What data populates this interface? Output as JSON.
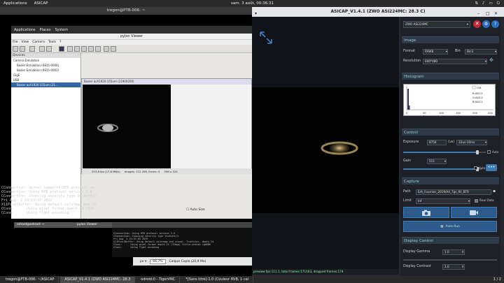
{
  "topbar": {
    "applications": "Applications",
    "app_name": "ASICAP",
    "datetime": "sam. 3 août, 00:36:31",
    "sys_icons": [
      "network-icon",
      "volume-icon",
      "battery-icon",
      "power-icon"
    ]
  },
  "vnc": {
    "title": "tregon@PTB-006: ~",
    "menu": [
      "Applications",
      "Places",
      "System"
    ],
    "pylon_title": "pylon Viewer",
    "pylon_menu": [
      "File",
      "View",
      "Camera",
      "Tools",
      "?"
    ],
    "devices_header": "Devices",
    "devices": [
      "Camera Emulation",
      "Basler Emulation (0815-0000)",
      "Basler Emulation (0815-0001)",
      "GigE",
      "USB",
      "Basler acA1920-155um (21..."
    ],
    "cam_title": "Basler acA1920-155um (21900200)",
    "cam_status": [
      "253,8 fps (27,6 MB/s)",
      "Images: 112 258, Errors: 0",
      "336 x 320"
    ],
    "auto_size_label": "Auto Size",
    "odroid_title": "odroid@odroid: ~",
    "pylon_mini": "pylon Viewer",
    "bottom_zoom": "66,7%",
    "bottom_copy": "Calque Copie (20,9 Mo)",
    "terminal_lines": [
      "CConnection: Server supports RFB protocol ve",
      "CConnection: Using RFB protocol version 3.8",
      "CConnection: Choosing security type VncAuth(2",
      "",
      "Fri Aug  2 23:57:03 2019",
      "X11PixelBuffer: Using default colormap and vi",
      "CConn:      Using pixel format depth 24 (32b",
      "CConn:      Using Tight encoding"
    ],
    "inner_lines": [
      "CConnection: Using RFB protocol version 3.8",
      "CConnection: Choosing security type VncAuth(2)",
      "",
      "Fri Aug  2 23:57:03 2019",
      "X11PixelBuffer: Using default colormap and visual, TrueColor, depth 24.",
      "CConn:      Using pixel format depth 24 (32bpp) little-endian rgb888",
      "CConn:      Using Tight encoding"
    ]
  },
  "asicap": {
    "title": "ASICAP_V1.4.1 (ZWO ASI224MC: 28.3 C)",
    "camera_select": "ZWO ASI224MC",
    "sections": {
      "image": "Image",
      "histogram": "Histogram",
      "control": "Control",
      "capture": "Capture",
      "display_control": "Display Control"
    },
    "image": {
      "format_label": "Format",
      "format_value": "RAW8",
      "bin_label": "Bin",
      "bin_value": "Bin1",
      "resolution_label": "Resolution",
      "resolution_value": "640*480"
    },
    "histogram": {
      "log_label": "Log",
      "ticks": [
        "0",
        "50",
        "100",
        "150",
        "200",
        "255"
      ],
      "readouts": [
        "R:AVG:2",
        "G:AVG:2",
        "B:AVG:2"
      ]
    },
    "control": {
      "exposure_label": "Exposure",
      "exposure_value": "8754",
      "exposure_unit": "(us)",
      "exposure_range": "32us-16ms",
      "gain_label": "Gain",
      "gain_value": "511",
      "auto_label": "Auto",
      "exposure_slider": 0.9,
      "gain_slider": 0.95
    },
    "capture": {
      "path_label": "Path",
      "path_value": "E/A_Fournier_2019/A4_Tgs_fill_BTR",
      "limit_label": "Limit",
      "limit_value": "Inf",
      "raw_data_label": "Raw Data",
      "auto_run_label": "Auto Run"
    },
    "display": {
      "gamma_label": "Display Gamma",
      "gamma_value": "1.0",
      "contrast_label": "Display Contrast",
      "contrast_value": "1.0"
    },
    "status": "preview fps:111.1, total frames:171163, dropped frames:174"
  },
  "taskbar": {
    "tasks": [
      "tregon@PTB-006: ~/ASICAP",
      "ASICAP_V1.4.1 (ZWO ASI224MC: 28.3",
      "odroid:0 - TigerVNC",
      "*[Sans titre]-1.0 (Couleur RVB, 1 cal"
    ],
    "pager": "1 / 2"
  }
}
